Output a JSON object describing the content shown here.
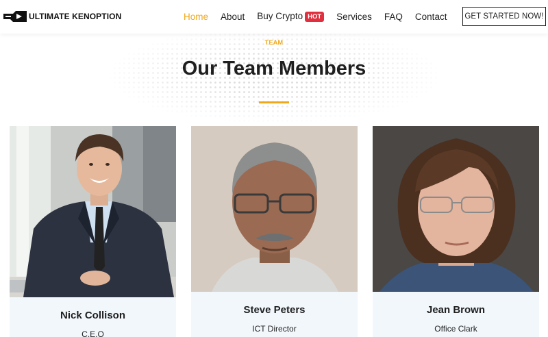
{
  "brand": {
    "name": "ULTIMATE KENOPTION"
  },
  "nav": {
    "items": [
      {
        "label": "Home",
        "active": true
      },
      {
        "label": "About"
      },
      {
        "label": "Buy Crypto",
        "badge": "HOT"
      },
      {
        "label": "Services"
      },
      {
        "label": "FAQ"
      },
      {
        "label": "Contact"
      }
    ],
    "cta": "GET STARTED NOW!"
  },
  "section": {
    "tag": "TEAM",
    "title": "Our Team Members"
  },
  "team": [
    {
      "name": "Nick Collison",
      "role": "C.E.O"
    },
    {
      "name": "Steve Peters",
      "role": "ICT Director"
    },
    {
      "name": "Jean Brown",
      "role": "Office Clark"
    }
  ],
  "colors": {
    "accent": "#f0a81a",
    "hot_badge": "#e03040",
    "card_bg": "#f2f7fc",
    "text": "#1f1f1f"
  }
}
